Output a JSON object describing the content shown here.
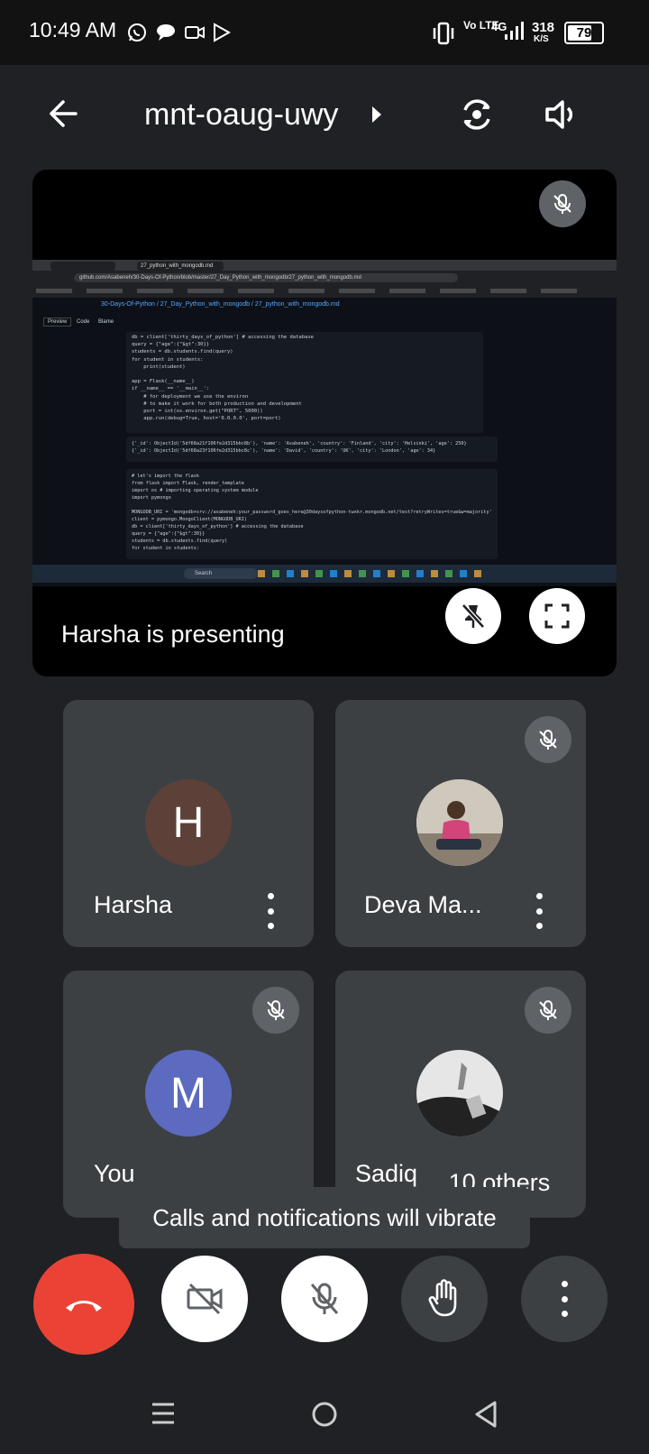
{
  "status_bar": {
    "time": "10:49 AM",
    "network": "Vo LTE",
    "signal": "4G",
    "speed": "318",
    "speed_unit": "K/S",
    "battery": "79"
  },
  "header": {
    "meeting_code": "mnt-oaug-uwy"
  },
  "presentation": {
    "label": "Harsha is presenting",
    "screen": {
      "tab_title": "27_python_with_mongodb.md",
      "url": "github.com/Asabeneh/30-Days-Of-Python/blob/master/27_Day_Python_with_mongodb/27_python_with_mongodb.md",
      "breadcrumb": "30-Days-Of-Python / 27_Day_Python_with_mongodb / 27_python_with_mongodb.md",
      "tabs": [
        "Preview",
        "Code",
        "Blame"
      ],
      "code_lines": [
        "db = client['thirty_days_of_python'] # accessing the database",
        "query = {\"age\":{\"$gt\":30}}",
        "students = db.students.find(query)",
        "for student in students:",
        "    print(student)",
        "",
        "app = Flask(__name__)",
        "if __name__ == '__main__':",
        "    # for deployment we use the environ",
        "    # to make it work for both production and development",
        "    port = int(os.environ.get(\"PORT\", 5000))",
        "    app.run(debug=True, host='0.0.0.0', port=port)"
      ],
      "output_lines": [
        "{'_id': ObjectId('5df68a21f106fe2d315bbc8b'), 'name': 'Asabeneh', 'country': 'Finland', 'city': 'Helsinki', 'age': 250}",
        "{'_id': ObjectId('5df68a23f106fe2d315bbc8c'), 'name': 'David', 'country': 'UK', 'city': 'London', 'age': 34}"
      ],
      "code2_lines": [
        "# let's import the flask",
        "from flask import Flask, render_template",
        "import os # importing operating system module",
        "import pymongo",
        "",
        "MONGODB_URI = 'mongodb+srv://asabeneh:your_password_goes_here@30daysofpython-twxkr.mongodb.net/test?retryWrites=true&w=majority'",
        "client = pymongo.MongoClient(MONGODB_URI)",
        "db = client['thirty_days_of_python'] # accessing the database",
        "query = {\"age\":{\"$gt\":30}}",
        "students = db.students.find(query)",
        "for student in students:"
      ],
      "taskbar_search": "Search"
    }
  },
  "participants": [
    {
      "name": "Harsha",
      "initial": "H",
      "color": "#5d4037",
      "muted": false
    },
    {
      "name": "Deva Ma...",
      "initial": "",
      "color": "#7a6a60",
      "muted": true
    },
    {
      "name": "You",
      "initial": "M",
      "color": "#5c6bc0",
      "muted": true
    },
    {
      "name": "Sadiq",
      "initial": "",
      "color": "#555",
      "muted": true
    }
  ],
  "others_label": "10 others",
  "toast": "Calls and notifications will vibrate"
}
